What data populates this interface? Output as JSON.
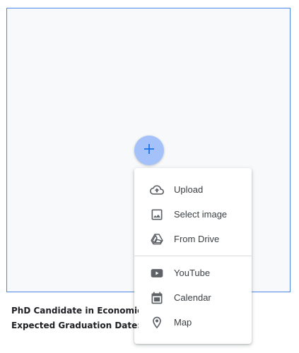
{
  "page_text": {
    "line1": "PhD Candidate in Economics",
    "line2": "Expected Graduation Date: Mo"
  },
  "fab": {
    "icon": "plus-icon",
    "color": "#a4c2f9",
    "icon_color": "#1a73e8"
  },
  "insert_menu": {
    "group1": [
      {
        "label": "Upload",
        "icon": "cloud-upload-icon"
      },
      {
        "label": "Select image",
        "icon": "image-icon"
      },
      {
        "label": "From Drive",
        "icon": "drive-icon"
      }
    ],
    "group2": [
      {
        "label": "YouTube",
        "icon": "youtube-icon"
      },
      {
        "label": "Calendar",
        "icon": "calendar-icon"
      },
      {
        "label": "Map",
        "icon": "map-pin-icon"
      }
    ]
  },
  "colors": {
    "placeholder_border": "#4a86e8",
    "icon": "#5f6368",
    "text": "#3c4043"
  }
}
